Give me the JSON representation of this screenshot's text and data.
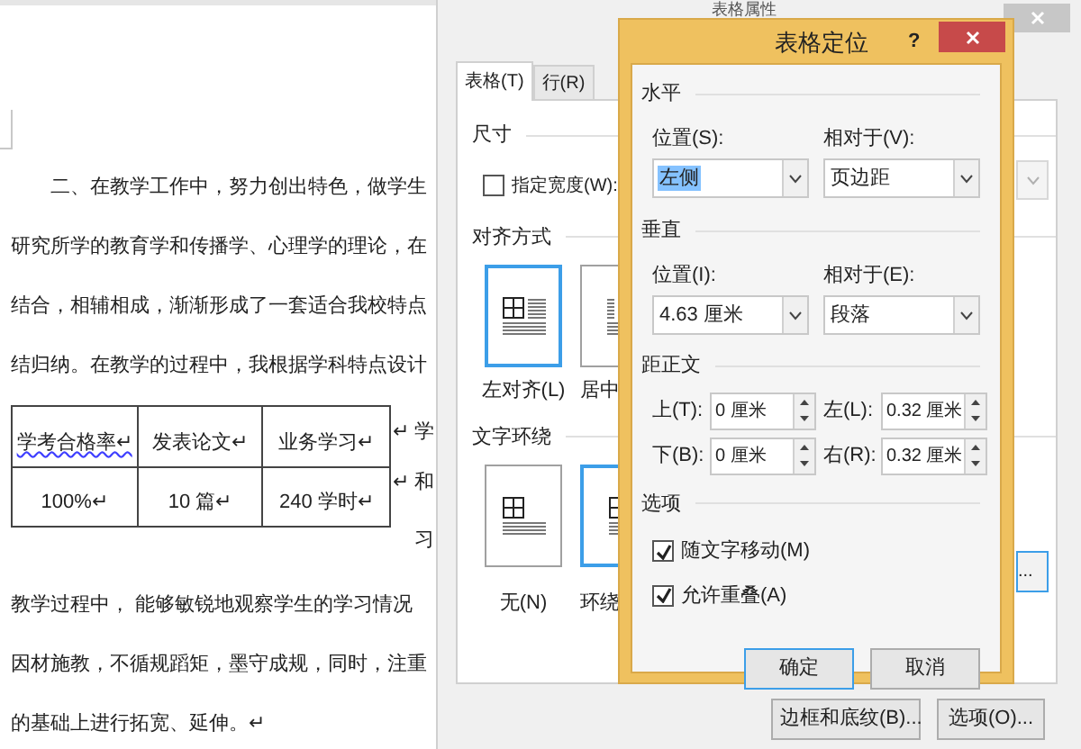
{
  "document": {
    "lines_before": [
      "二、在教学工作中，努力创出特色，做学生",
      "研究所学的教育学和传播学、心理学的理论，在",
      "结合，相辅相成，渐渐形成了一套适合我校特点",
      "结归纳。在教学的过程中，我根据学科特点设计"
    ],
    "table": {
      "rows": [
        [
          "学考合格率↵",
          "发表论文↵",
          "业务学习↵"
        ],
        [
          "100%↵",
          "10 篇↵",
          "240 学时↵"
        ]
      ]
    },
    "side_text": [
      "↵ 学",
      "↵ 和",
      "习"
    ],
    "lines_after": [
      "教学过程中， 能够敏锐地观察学生的学习情况",
      "因材施教，不循规蹈矩，墨守成规，同时，注重",
      "的基础上进行拓宽、延伸。↵"
    ]
  },
  "table_properties_dialog": {
    "title": "表格属性",
    "tabs": [
      {
        "label": "表格(T)",
        "selected": true
      },
      {
        "label": "行(R)",
        "selected": false
      }
    ],
    "size_section": "尺寸",
    "preferred_width": {
      "label": "指定宽度(W):",
      "checked": false
    },
    "alignment_section": "对齐方式",
    "alignment_options": [
      {
        "label": "左对齐(L)",
        "kind": "left",
        "selected": true
      },
      {
        "label": "居中",
        "kind": "center",
        "selected": false
      }
    ],
    "wrap_section": "文字环绕",
    "wrap_options": [
      {
        "label": "无(N)",
        "kind": "none",
        "selected": false
      },
      {
        "label": "环绕",
        "kind": "around",
        "selected": true
      }
    ],
    "positioning_button": "...",
    "buttons": [
      "边框和底纹(B)...",
      "选项(O)..."
    ]
  },
  "table_positioning_dialog": {
    "title": "表格定位",
    "help": "?",
    "horizontal": {
      "title": "水平",
      "position": {
        "label": "位置(S):",
        "value": "左侧",
        "highlighted": true
      },
      "relative_to": {
        "label": "相对于(V):",
        "value": "页边距",
        "highlighted": false
      }
    },
    "vertical": {
      "title": "垂直",
      "position": {
        "label": "位置(I):",
        "value": "4.63 厘米",
        "highlighted": false
      },
      "relative_to": {
        "label": "相对于(E):",
        "value": "段落",
        "highlighted": false
      }
    },
    "distance": {
      "title": "距正文",
      "fields": [
        {
          "label": "上(T):",
          "value": "0 厘米"
        },
        {
          "label": "左(L):",
          "value": "0.32 厘米"
        },
        {
          "label": "下(B):",
          "value": "0 厘米"
        },
        {
          "label": "右(R):",
          "value": "0.32 厘米"
        }
      ]
    },
    "options": {
      "title": "选项",
      "checkboxes": [
        {
          "label": "随文字移动(M)",
          "checked": true
        },
        {
          "label": "允许重叠(A)",
          "checked": true
        }
      ]
    },
    "buttons": [
      {
        "label": "确定",
        "default": true
      },
      {
        "label": "取消",
        "default": false
      }
    ]
  }
}
